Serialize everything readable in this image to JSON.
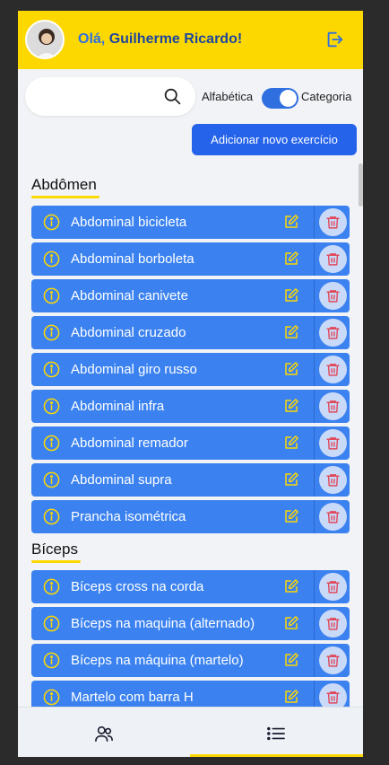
{
  "header": {
    "greeting": "Olá,",
    "user_name": "Guilherme Ricardo!"
  },
  "search": {
    "placeholder": ""
  },
  "sort": {
    "left_label": "Alfabética",
    "right_label": "Categoria"
  },
  "add_button": "Adicionar novo exercício",
  "groups": [
    {
      "title": "Abdômen",
      "items": [
        "Abdominal bicicleta",
        "Abdominal borboleta",
        "Abdominal canivete",
        "Abdominal cruzado",
        "Abdominal giro russo",
        "Abdominal infra",
        "Abdominal remador",
        "Abdominal supra",
        "Prancha isométrica"
      ]
    },
    {
      "title": "Bíceps",
      "items": [
        "Bíceps cross na corda",
        "Bíceps na maquina (alternado)",
        "Bíceps na máquina (martelo)",
        "Martelo com barra H",
        ""
      ]
    }
  ],
  "colors": {
    "header": "#fdd800",
    "accent": "#2563eb",
    "row": "#3b82f0"
  },
  "icons": {
    "logout": "logout-icon",
    "search": "search-icon",
    "info": "info-icon",
    "edit": "edit-icon",
    "delete": "trash-icon",
    "users": "users-icon",
    "list": "list-icon"
  }
}
